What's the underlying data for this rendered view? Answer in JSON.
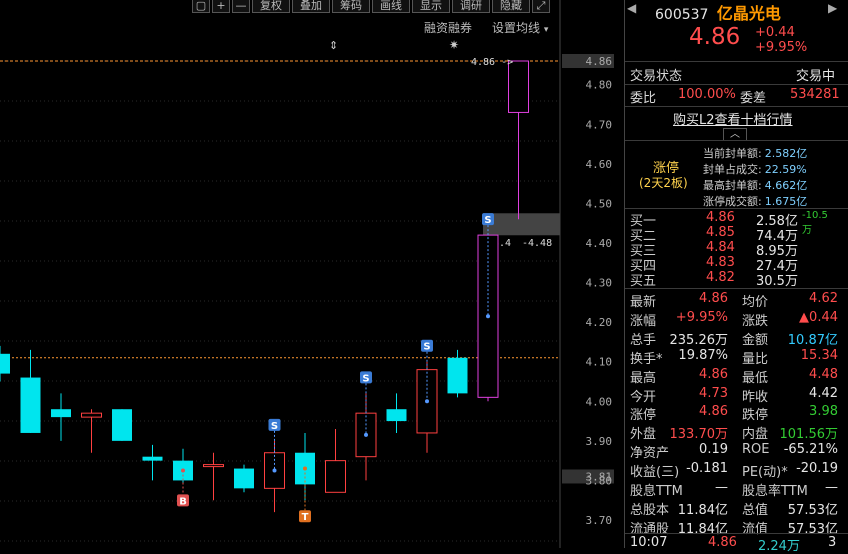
{
  "toolbar": {
    "buttons": [
      "+",
      "—",
      "复权",
      "叠加",
      "筹码",
      "画线",
      "显示",
      "调研",
      "隐藏"
    ],
    "rongzi": "融资融券",
    "ma_setting": "设置均线"
  },
  "chart_data": {
    "type": "candlestick",
    "ylim": [
      3.65,
      4.88
    ],
    "y_ticks": [
      "4.86",
      "4.80",
      "4.70",
      "4.60",
      "4.50",
      "4.40",
      "4.30",
      "4.20",
      "4.10",
      "4.00",
      "3.90",
      "3.81",
      "3.80",
      "3.70"
    ],
    "limit_price_label": "4.86",
    "current_price_label": "3.81",
    "prev_close_level": 4.11,
    "candles": [
      {
        "o": 4.12,
        "c": 4.07,
        "h": 4.14,
        "l": 4.05,
        "up": false
      },
      {
        "o": 4.06,
        "c": 3.92,
        "h": 4.13,
        "l": 3.92,
        "up": false
      },
      {
        "o": 3.98,
        "c": 3.96,
        "h": 4.02,
        "l": 3.9,
        "up": false
      },
      {
        "o": 3.97,
        "c": 3.96,
        "h": 3.98,
        "l": 3.87,
        "up": true
      },
      {
        "o": 3.98,
        "c": 3.9,
        "h": 3.98,
        "l": 3.9,
        "up": false
      },
      {
        "o": 3.86,
        "c": 3.85,
        "h": 3.89,
        "l": 3.8,
        "up": false
      },
      {
        "o": 3.85,
        "c": 3.8,
        "h": 3.88,
        "l": 3.79,
        "up": false
      },
      {
        "o": 3.84,
        "c": 3.84,
        "h": 3.87,
        "l": 3.75,
        "up": true
      },
      {
        "o": 3.83,
        "c": 3.78,
        "h": 3.84,
        "l": 3.77,
        "up": false
      },
      {
        "o": 3.78,
        "c": 3.87,
        "h": 3.9,
        "l": 3.72,
        "up": true
      },
      {
        "o": 3.87,
        "c": 3.79,
        "h": 3.92,
        "l": 3.75,
        "up": false
      },
      {
        "o": 3.77,
        "c": 3.85,
        "h": 3.93,
        "l": 3.77,
        "up": true
      },
      {
        "o": 3.86,
        "c": 3.97,
        "h": 4.02,
        "l": 3.8,
        "up": true
      },
      {
        "o": 3.95,
        "c": 3.98,
        "h": 4.02,
        "l": 3.92,
        "up": false
      },
      {
        "o": 3.92,
        "c": 4.08,
        "h": 4.1,
        "l": 3.87,
        "up": true
      },
      {
        "o": 4.02,
        "c": 4.11,
        "h": 4.13,
        "l": 4.01,
        "up": false
      },
      {
        "o": 4.01,
        "c": 4.42,
        "h": 4.42,
        "l": 4.0,
        "up": true
      },
      {
        "o": 4.73,
        "c": 4.86,
        "h": 4.86,
        "l": 4.46,
        "up": true
      }
    ],
    "markers": [
      {
        "candle": 6,
        "label": "B",
        "pos": "below"
      },
      {
        "candle": 9,
        "label": "S",
        "pos": "above"
      },
      {
        "candle": 10,
        "label": "T",
        "pos": "below"
      },
      {
        "candle": 12,
        "label": "S",
        "pos": "above"
      },
      {
        "candle": 14,
        "label": "S",
        "pos": "above"
      },
      {
        "candle": 16,
        "label": "S",
        "pos": "above"
      }
    ],
    "gap_label": "4.4",
    "gap_value": "4.48",
    "gap_range": [
      4.42,
      4.46
    ]
  },
  "panel": {
    "code": "600537",
    "name": "亿晶光电",
    "price": "4.86",
    "change": "+0.44",
    "change_pct": "+9.95%",
    "trade_status_label": "交易状态",
    "trade_status": "交易中",
    "weibi_label": "委比",
    "weibi": "100.00%",
    "weicha_label": "委差",
    "weicha": "534281",
    "l2_link": "购买L2查看十档行情",
    "limit_up": "涨停",
    "limit_days": "(2天2板)",
    "seal_items": [
      {
        "label": "当前封单额:",
        "value": "2.582亿"
      },
      {
        "label": "封单占成交:",
        "value": "22.59%"
      },
      {
        "label": "最高封单额:",
        "value": "4.662亿"
      },
      {
        "label": "涨停成交额:",
        "value": "1.675亿"
      }
    ],
    "bids": [
      {
        "label": "买一",
        "price": "4.86",
        "vol": "2.58亿",
        "extra": "-10.5万"
      },
      {
        "label": "买二",
        "price": "4.85",
        "vol": "74.4万",
        "extra": ""
      },
      {
        "label": "买三",
        "price": "4.84",
        "vol": "8.95万",
        "extra": ""
      },
      {
        "label": "买四",
        "price": "4.83",
        "vol": "27.4万",
        "extra": ""
      },
      {
        "label": "买五",
        "price": "4.82",
        "vol": "30.5万",
        "extra": ""
      }
    ],
    "quotes": [
      {
        "l1": "最新",
        "v1": "4.86",
        "c1": "red",
        "l2": "均价",
        "v2": "4.62",
        "c2": "red"
      },
      {
        "l1": "涨幅",
        "v1": "+9.95%",
        "c1": "red",
        "l2": "涨跌",
        "v2": "▲0.44",
        "c2": "red"
      },
      {
        "l1": "总手",
        "v1": "235.26万",
        "c1": "white",
        "l2": "金额",
        "v2": "10.87亿",
        "c2": "cyan"
      },
      {
        "l1": "换手*",
        "v1": "19.87%",
        "c1": "white",
        "l2": "量比",
        "v2": "15.34",
        "c2": "red"
      },
      {
        "l1": "最高",
        "v1": "4.86",
        "c1": "red",
        "l2": "最低",
        "v2": "4.48",
        "c2": "red"
      },
      {
        "l1": "今开",
        "v1": "4.73",
        "c1": "red",
        "l2": "昨收",
        "v2": "4.42",
        "c2": "white"
      },
      {
        "l1": "涨停",
        "v1": "4.86",
        "c1": "red",
        "l2": "跌停",
        "v2": "3.98",
        "c2": "green"
      },
      {
        "l1": "外盘",
        "v1": "133.70万",
        "c1": "red",
        "l2": "内盘",
        "v2": "101.56万",
        "c2": "green"
      },
      {
        "l1": "净资产",
        "v1": "0.19",
        "c1": "white",
        "l2": "ROE",
        "v2": "-65.21%",
        "c2": "white"
      },
      {
        "l1": "收益(三)",
        "v1": "-0.181",
        "c1": "white",
        "l2": "PE(动)*",
        "v2": "-20.19",
        "c2": "white"
      },
      {
        "l1": "股息TTM",
        "v1": "—",
        "c1": "white",
        "l2": "股息率TTM",
        "v2": "—",
        "c2": "white"
      },
      {
        "l1": "总股本",
        "v1": "11.84亿",
        "c1": "white",
        "l2": "总值",
        "v2": "57.53亿",
        "c2": "white"
      },
      {
        "l1": "流通股",
        "v1": "11.84亿",
        "c1": "white",
        "l2": "流值",
        "v2": "57.53亿",
        "c2": "white"
      }
    ],
    "tick": {
      "time": "10:07",
      "price": "4.86",
      "vol": "2.24万",
      "n": "3"
    }
  }
}
